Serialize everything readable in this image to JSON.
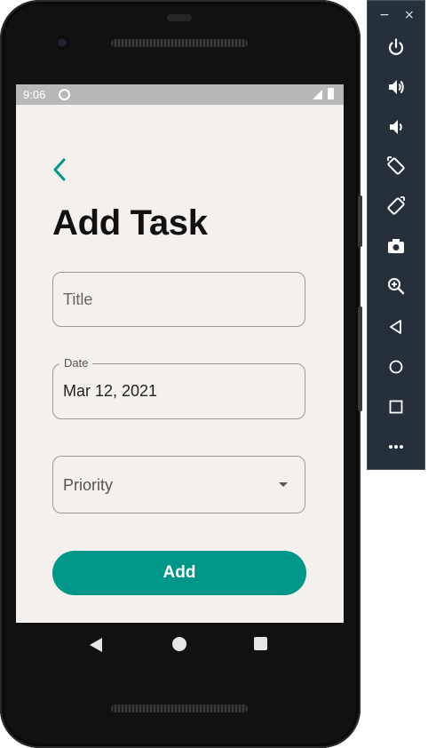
{
  "status_bar": {
    "time": "9:06"
  },
  "screen": {
    "title": "Add Task",
    "title_field": {
      "placeholder": "Title",
      "value": ""
    },
    "date_field": {
      "label": "Date",
      "value": "Mar 12, 2021"
    },
    "priority_field": {
      "placeholder": "Priority"
    },
    "add_button": {
      "label": "Add"
    }
  },
  "emulator_toolbar": {
    "minimize": "−",
    "close": "×",
    "buttons": [
      "power-icon",
      "volume-up-icon",
      "volume-down-icon",
      "rotate-left-icon",
      "rotate-right-icon",
      "camera-icon",
      "zoom-icon",
      "back-icon",
      "home-icon",
      "overview-icon",
      "more-icon"
    ]
  },
  "colors": {
    "accent": "#009688",
    "screen_background": "#f3f0ed",
    "status_bar": "#b8b8b8",
    "toolbar_background": "#26303a"
  }
}
